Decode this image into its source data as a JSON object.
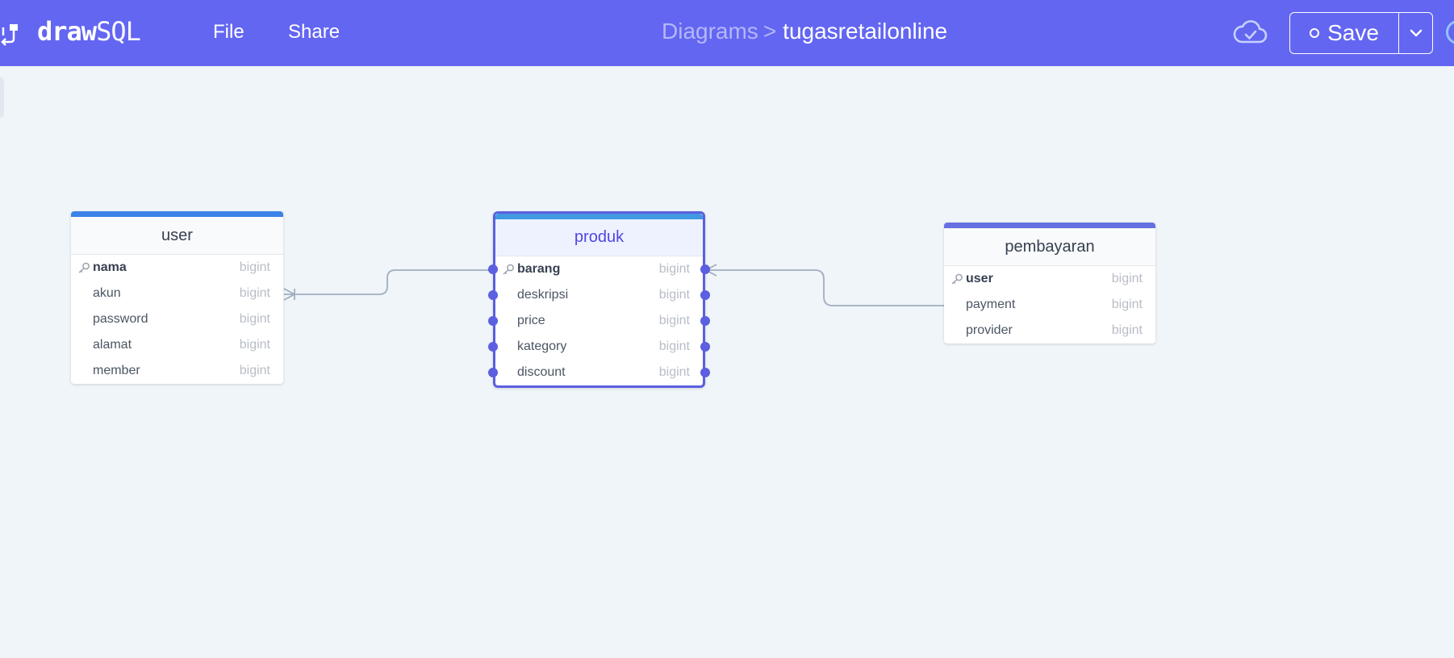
{
  "app": {
    "logo_bold": "draw",
    "logo_light": "SQL"
  },
  "menu": {
    "file": "File",
    "share": "Share"
  },
  "breadcrumb": {
    "parent": "Diagrams",
    "separator": ">",
    "current": "tugasretailonline"
  },
  "toolbar": {
    "save_label": "Save"
  },
  "colors": {
    "header": "#6366f1",
    "canvas": "#eff5f8",
    "user_table_bar": "#3b82e8",
    "produk_table_bar": "#4299e1",
    "pembayaran_table_bar": "#6670e0",
    "selected_outline": "#5b5fe0",
    "relationship_line": "#a0aec0"
  },
  "tables": {
    "user": {
      "name": "user",
      "fields": [
        {
          "name": "nama",
          "type": "bigint",
          "primary": true
        },
        {
          "name": "akun",
          "type": "bigint",
          "primary": false
        },
        {
          "name": "password",
          "type": "bigint",
          "primary": false
        },
        {
          "name": "alamat",
          "type": "bigint",
          "primary": false
        },
        {
          "name": "member",
          "type": "bigint",
          "primary": false
        }
      ]
    },
    "produk": {
      "name": "produk",
      "selected": true,
      "fields": [
        {
          "name": "barang",
          "type": "bigint",
          "primary": true
        },
        {
          "name": "deskripsi",
          "type": "bigint",
          "primary": false
        },
        {
          "name": "price",
          "type": "bigint",
          "primary": false
        },
        {
          "name": "kategory",
          "type": "bigint",
          "primary": false
        },
        {
          "name": "discount",
          "type": "bigint",
          "primary": false
        }
      ]
    },
    "pembayaran": {
      "name": "pembayaran",
      "fields": [
        {
          "name": "user",
          "type": "bigint",
          "primary": true
        },
        {
          "name": "payment",
          "type": "bigint",
          "primary": false
        },
        {
          "name": "provider",
          "type": "bigint",
          "primary": false
        }
      ]
    }
  },
  "relationships": [
    {
      "from": "user.akun",
      "to": "produk.barang",
      "from_end": "many"
    },
    {
      "from": "produk.barang",
      "to": "pembayaran.payment",
      "from_end": "many"
    }
  ]
}
